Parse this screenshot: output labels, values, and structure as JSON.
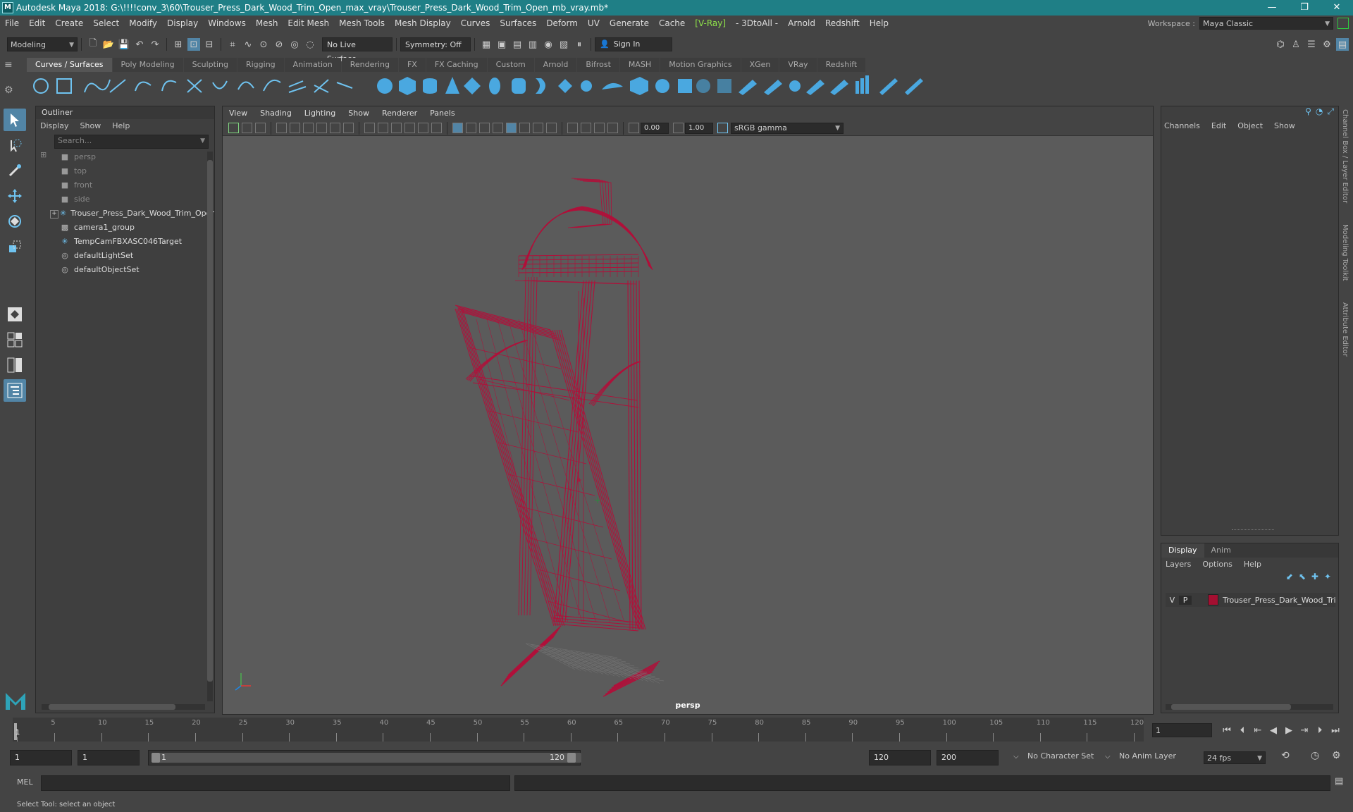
{
  "window": {
    "title": "Autodesk Maya 2018: G:\\!!!!conv_3\\60\\Trouser_Press_Dark_Wood_Trim_Open_max_vray\\Trouser_Press_Dark_Wood_Trim_Open_mb_vray.mb*",
    "minimize": "—",
    "restore": "❐",
    "close": "✕"
  },
  "menubar": {
    "items": [
      "File",
      "Edit",
      "Create",
      "Select",
      "Modify",
      "Display",
      "Windows",
      "Mesh",
      "Edit Mesh",
      "Mesh Tools",
      "Mesh Display",
      "Curves",
      "Surfaces",
      "Deform",
      "UV",
      "Generate",
      "Cache"
    ],
    "vray": "[V-Ray]",
    "items2": [
      "- 3DtoAll -",
      "Arnold",
      "Redshift",
      "Help"
    ],
    "workspace_label": "Workspace :",
    "workspace_value": "Maya Classic"
  },
  "statusline": {
    "mode": "Modeling",
    "live_surface": "No Live Surface",
    "symmetry": "Symmetry: Off",
    "sign_in": "Sign In"
  },
  "shelf": {
    "tabs": [
      "Curves / Surfaces",
      "Poly Modeling",
      "Sculpting",
      "Rigging",
      "Animation",
      "Rendering",
      "FX",
      "FX Caching",
      "Custom",
      "Arnold",
      "Bifrost",
      "MASH",
      "Motion Graphics",
      "XGen",
      "VRay",
      "Redshift"
    ],
    "active_tab": 0
  },
  "outliner": {
    "title": "Outliner",
    "menu": [
      "Display",
      "Show",
      "Help"
    ],
    "search_placeholder": "Search...",
    "items": [
      {
        "label": "persp",
        "dim": true,
        "icon": "camera-icon"
      },
      {
        "label": "top",
        "dim": true,
        "icon": "camera-icon"
      },
      {
        "label": "front",
        "dim": true,
        "icon": "camera-icon"
      },
      {
        "label": "side",
        "dim": true,
        "icon": "camera-icon"
      },
      {
        "label": "Trouser_Press_Dark_Wood_Trim_Open",
        "dim": false,
        "icon": "transform-icon"
      },
      {
        "label": "camera1_group",
        "dim": false,
        "icon": "group-icon"
      },
      {
        "label": "TempCamFBXASC046Target",
        "dim": false,
        "icon": "transform-icon"
      },
      {
        "label": "defaultLightSet",
        "dim": false,
        "icon": "set-icon"
      },
      {
        "label": "defaultObjectSet",
        "dim": false,
        "icon": "set-icon"
      }
    ]
  },
  "viewport": {
    "menu": [
      "View",
      "Shading",
      "Lighting",
      "Show",
      "Renderer",
      "Panels"
    ],
    "exposure": "0.00",
    "gamma": "1.00",
    "color_space": "sRGB gamma",
    "camera": "persp",
    "wire_color": "#b0103a"
  },
  "channelbox": {
    "menu": [
      "Channels",
      "Edit",
      "Object",
      "Show"
    ]
  },
  "layereditor": {
    "tabs": [
      "Display",
      "Anim"
    ],
    "menu": [
      "Layers",
      "Options",
      "Help"
    ],
    "layer": {
      "v": "V",
      "p": "P",
      "name": "Trouser_Press_Dark_Wood_Trim"
    }
  },
  "sidetabs": [
    "Channel Box / Layer Editor",
    "Modeling Toolkit",
    "Attribute Editor"
  ],
  "timeslider": {
    "labels": [
      "5",
      "10",
      "15",
      "20",
      "25",
      "30",
      "35",
      "40",
      "45",
      "50",
      "55",
      "60",
      "65",
      "70",
      "75",
      "80",
      "85",
      "90",
      "95",
      "100",
      "105",
      "110",
      "115",
      "120"
    ],
    "current": "1",
    "current_frame_field": "1"
  },
  "range": {
    "start": "1",
    "playback_start": "1",
    "range_left": "1",
    "range_right": "120",
    "playback_end": "120",
    "end": "200",
    "character_set": "No Character Set",
    "anim_layer": "No Anim Layer",
    "fps": "24 fps"
  },
  "cmdline": {
    "label": "MEL"
  },
  "helpline": {
    "text": "Select Tool: select an object"
  }
}
